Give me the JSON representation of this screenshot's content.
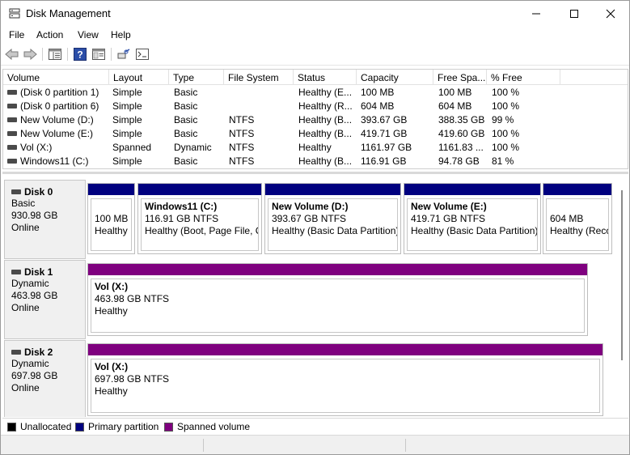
{
  "window": {
    "title": "Disk Management"
  },
  "menu": [
    "File",
    "Action",
    "View",
    "Help"
  ],
  "toolbar": {
    "icons": [
      "back-arrow-icon",
      "forward-arrow-icon",
      "volume-list-icon",
      "help-icon",
      "properties-icon",
      "rescan-disks-icon",
      "console-icon"
    ]
  },
  "columns": [
    "Volume",
    "Layout",
    "Type",
    "File System",
    "Status",
    "Capacity",
    "Free Spa...",
    "% Free"
  ],
  "volumes": [
    {
      "volume": "(Disk 0 partition 1)",
      "layout": "Simple",
      "type": "Basic",
      "fs": "",
      "status": "Healthy (E...",
      "capacity": "100 MB",
      "free": "100 MB",
      "pct": "100 %"
    },
    {
      "volume": "(Disk 0 partition 6)",
      "layout": "Simple",
      "type": "Basic",
      "fs": "",
      "status": "Healthy (R...",
      "capacity": "604 MB",
      "free": "604 MB",
      "pct": "100 %"
    },
    {
      "volume": "New Volume (D:)",
      "layout": "Simple",
      "type": "Basic",
      "fs": "NTFS",
      "status": "Healthy (B...",
      "capacity": "393.67 GB",
      "free": "388.35 GB",
      "pct": "99 %"
    },
    {
      "volume": "New Volume (E:)",
      "layout": "Simple",
      "type": "Basic",
      "fs": "NTFS",
      "status": "Healthy (B...",
      "capacity": "419.71 GB",
      "free": "419.60 GB",
      "pct": "100 %"
    },
    {
      "volume": "Vol (X:)",
      "layout": "Spanned",
      "type": "Dynamic",
      "fs": "NTFS",
      "status": "Healthy",
      "capacity": "1161.97 GB",
      "free": "1161.83 ...",
      "pct": "100 %"
    },
    {
      "volume": "Windows11 (C:)",
      "layout": "Simple",
      "type": "Basic",
      "fs": "NTFS",
      "status": "Healthy (B...",
      "capacity": "116.91 GB",
      "free": "94.78 GB",
      "pct": "81 %"
    }
  ],
  "disks": [
    {
      "name": "Disk 0",
      "type": "Basic",
      "size": "930.98 GB",
      "state": "Online",
      "partitions": [
        {
          "title": "",
          "size": "100 MB",
          "status": "Healthy",
          "color": "#00007f"
        },
        {
          "title": "Windows11  (C:)",
          "size": "116.91 GB NTFS",
          "status": "Healthy (Boot, Page File, C",
          "color": "#00007f"
        },
        {
          "title": "New Volume  (D:)",
          "size": "393.67 GB NTFS",
          "status": "Healthy (Basic Data Partition)",
          "color": "#00007f"
        },
        {
          "title": "New Volume  (E:)",
          "size": "419.71 GB NTFS",
          "status": "Healthy (Basic Data Partition)",
          "color": "#00007f"
        },
        {
          "title": "",
          "size": "604 MB",
          "status": "Healthy (Recc",
          "color": "#00007f"
        }
      ]
    },
    {
      "name": "Disk 1",
      "type": "Dynamic",
      "size": "463.98 GB",
      "state": "Online",
      "partitions": [
        {
          "title": "Vol  (X:)",
          "size": "463.98 GB NTFS",
          "status": "Healthy",
          "color": "#7f007f"
        }
      ]
    },
    {
      "name": "Disk 2",
      "type": "Dynamic",
      "size": "697.98 GB",
      "state": "Online",
      "partitions": [
        {
          "title": "Vol  (X:)",
          "size": "697.98 GB NTFS",
          "status": "Healthy",
          "color": "#7f007f"
        }
      ]
    }
  ],
  "legend": [
    {
      "label": "Unallocated",
      "color": "#000000"
    },
    {
      "label": "Primary partition",
      "color": "#00007f"
    },
    {
      "label": "Spanned volume",
      "color": "#7f007f"
    }
  ]
}
